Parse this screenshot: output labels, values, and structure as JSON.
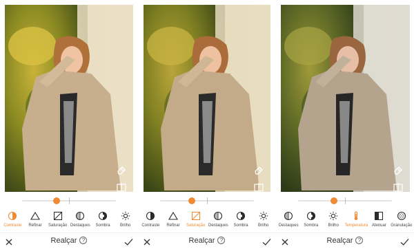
{
  "accent_color": "#f08a34",
  "panels": [
    {
      "tools": [
        {
          "label": "Contraste",
          "icon": "contrast-icon",
          "active": true
        },
        {
          "label": "Refinar",
          "icon": "triangle-icon",
          "active": false
        },
        {
          "label": "Saturação",
          "icon": "saturation-icon",
          "active": false
        },
        {
          "label": "Destaques",
          "icon": "highlights-icon",
          "active": false
        },
        {
          "label": "Sombra",
          "icon": "shadow-icon",
          "active": false
        },
        {
          "label": "Brilho",
          "icon": "sun-icon",
          "active": false
        }
      ],
      "slider_value": 0.37,
      "title": "Realçar",
      "help": "?"
    },
    {
      "tools": [
        {
          "label": "Contraste",
          "icon": "contrast-icon",
          "active": false
        },
        {
          "label": "Refinar",
          "icon": "triangle-icon",
          "active": false
        },
        {
          "label": "Saturação",
          "icon": "saturation-icon",
          "active": true
        },
        {
          "label": "Destaques",
          "icon": "highlights-icon",
          "active": false
        },
        {
          "label": "Sombra",
          "icon": "shadow-icon",
          "active": false
        },
        {
          "label": "Brilho",
          "icon": "sun-icon",
          "active": false
        }
      ],
      "slider_value": 0.34,
      "title": "Realçar",
      "help": "?"
    },
    {
      "tools": [
        {
          "label": "Destaques",
          "icon": "highlights-icon",
          "active": false
        },
        {
          "label": "Sombra",
          "icon": "shadow-icon",
          "active": false
        },
        {
          "label": "Brilho",
          "icon": "sun-icon",
          "active": false
        },
        {
          "label": "Temperatura",
          "icon": "thermometer-icon",
          "active": true
        },
        {
          "label": "Atenuar",
          "icon": "fade-icon",
          "active": false
        },
        {
          "label": "Granulação",
          "icon": "grain-icon",
          "active": false
        }
      ],
      "slider_value": 0.38,
      "title": "Realçar",
      "help": "?"
    }
  ]
}
